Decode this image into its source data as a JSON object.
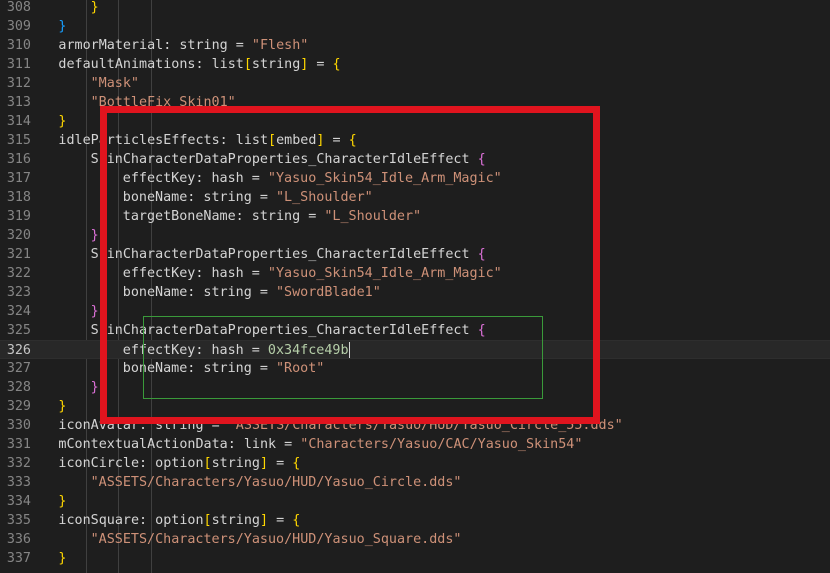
{
  "editor": {
    "current_line": "326",
    "lines": [
      {
        "num": "308",
        "indent": 3,
        "tokens": [
          {
            "t": "}",
            "c": "b1"
          }
        ]
      },
      {
        "num": "309",
        "indent": 2,
        "tokens": [
          {
            "t": "}",
            "c": "b3"
          }
        ]
      },
      {
        "num": "310",
        "indent": 2,
        "tokens": [
          {
            "t": "armorMaterial",
            "c": "p"
          },
          {
            "t": ": string = ",
            "c": "p"
          },
          {
            "t": "\"Flesh\"",
            "c": "s"
          }
        ]
      },
      {
        "num": "311",
        "indent": 2,
        "tokens": [
          {
            "t": "defaultAnimations",
            "c": "p"
          },
          {
            "t": ": list",
            "c": "p"
          },
          {
            "t": "[",
            "c": "b1"
          },
          {
            "t": "string",
            "c": "p"
          },
          {
            "t": "]",
            "c": "b1"
          },
          {
            "t": " = ",
            "c": "p"
          },
          {
            "t": "{",
            "c": "b1"
          }
        ]
      },
      {
        "num": "312",
        "indent": 3,
        "tokens": [
          {
            "t": "\"Mask\"",
            "c": "s"
          }
        ]
      },
      {
        "num": "313",
        "indent": 3,
        "tokens": [
          {
            "t": "\"BottleFix_Skin01\"",
            "c": "s"
          }
        ]
      },
      {
        "num": "314",
        "indent": 2,
        "tokens": [
          {
            "t": "}",
            "c": "b1"
          }
        ]
      },
      {
        "num": "315",
        "indent": 2,
        "tokens": [
          {
            "t": "idleParticlesEffects",
            "c": "p"
          },
          {
            "t": ": list",
            "c": "p"
          },
          {
            "t": "[",
            "c": "b1"
          },
          {
            "t": "embed",
            "c": "p"
          },
          {
            "t": "]",
            "c": "b1"
          },
          {
            "t": " = ",
            "c": "p"
          },
          {
            "t": "{",
            "c": "b1"
          }
        ]
      },
      {
        "num": "316",
        "indent": 3,
        "tokens": [
          {
            "t": "SkinCharacterDataProperties_CharacterIdleEffect ",
            "c": "p"
          },
          {
            "t": "{",
            "c": "b2"
          }
        ]
      },
      {
        "num": "317",
        "indent": 4,
        "tokens": [
          {
            "t": "effectKey",
            "c": "p"
          },
          {
            "t": ": hash = ",
            "c": "p"
          },
          {
            "t": "\"Yasuo_Skin54_Idle_Arm_Magic\"",
            "c": "s"
          }
        ]
      },
      {
        "num": "318",
        "indent": 4,
        "tokens": [
          {
            "t": "boneName",
            "c": "p"
          },
          {
            "t": ": string = ",
            "c": "p"
          },
          {
            "t": "\"L_Shoulder\"",
            "c": "s"
          }
        ]
      },
      {
        "num": "319",
        "indent": 4,
        "tokens": [
          {
            "t": "targetBoneName",
            "c": "p"
          },
          {
            "t": ": string = ",
            "c": "p"
          },
          {
            "t": "\"L_Shoulder\"",
            "c": "s"
          }
        ]
      },
      {
        "num": "320",
        "indent": 3,
        "tokens": [
          {
            "t": "}",
            "c": "b2"
          }
        ]
      },
      {
        "num": "321",
        "indent": 3,
        "tokens": [
          {
            "t": "SkinCharacterDataProperties_CharacterIdleEffect ",
            "c": "p"
          },
          {
            "t": "{",
            "c": "b2"
          }
        ]
      },
      {
        "num": "322",
        "indent": 4,
        "tokens": [
          {
            "t": "effectKey",
            "c": "p"
          },
          {
            "t": ": hash = ",
            "c": "p"
          },
          {
            "t": "\"Yasuo_Skin54_Idle_Arm_Magic\"",
            "c": "s"
          }
        ]
      },
      {
        "num": "323",
        "indent": 4,
        "tokens": [
          {
            "t": "boneName",
            "c": "p"
          },
          {
            "t": ": string = ",
            "c": "p"
          },
          {
            "t": "\"SwordBlade1\"",
            "c": "s"
          }
        ]
      },
      {
        "num": "324",
        "indent": 3,
        "tokens": [
          {
            "t": "}",
            "c": "b2"
          }
        ]
      },
      {
        "num": "325",
        "indent": 3,
        "tokens": [
          {
            "t": "SkinCharacterDataProperties_CharacterIdleEffect ",
            "c": "p"
          },
          {
            "t": "{",
            "c": "b2"
          }
        ]
      },
      {
        "num": "326",
        "indent": 4,
        "tokens": [
          {
            "t": "effectKey",
            "c": "p"
          },
          {
            "t": ": hash = ",
            "c": "p"
          },
          {
            "t": "0x34fce49b",
            "c": "n"
          }
        ],
        "cursor": true
      },
      {
        "num": "327",
        "indent": 4,
        "tokens": [
          {
            "t": "boneName",
            "c": "p"
          },
          {
            "t": ": string = ",
            "c": "p"
          },
          {
            "t": "\"Root\"",
            "c": "s"
          }
        ]
      },
      {
        "num": "328",
        "indent": 3,
        "tokens": [
          {
            "t": "}",
            "c": "b2"
          }
        ]
      },
      {
        "num": "329",
        "indent": 2,
        "tokens": [
          {
            "t": "}",
            "c": "b1"
          }
        ]
      },
      {
        "num": "330",
        "indent": 2,
        "tokens": [
          {
            "t": "iconAvatar",
            "c": "p"
          },
          {
            "t": ": string = ",
            "c": "p"
          },
          {
            "t": "\"ASSETS/Characters/Yasuo/HUD/Yasuo_Circle_55.dds\"",
            "c": "s"
          }
        ]
      },
      {
        "num": "331",
        "indent": 2,
        "tokens": [
          {
            "t": "mContextualActionData",
            "c": "p"
          },
          {
            "t": ": link = ",
            "c": "p"
          },
          {
            "t": "\"Characters/Yasuo/CAC/Yasuo_Skin54\"",
            "c": "s"
          }
        ]
      },
      {
        "num": "332",
        "indent": 2,
        "tokens": [
          {
            "t": "iconCircle",
            "c": "p"
          },
          {
            "t": ": option",
            "c": "p"
          },
          {
            "t": "[",
            "c": "b1"
          },
          {
            "t": "string",
            "c": "p"
          },
          {
            "t": "]",
            "c": "b1"
          },
          {
            "t": " = ",
            "c": "p"
          },
          {
            "t": "{",
            "c": "b1"
          }
        ]
      },
      {
        "num": "333",
        "indent": 3,
        "tokens": [
          {
            "t": "\"ASSETS/Characters/Yasuo/HUD/Yasuo_Circle.dds\"",
            "c": "s"
          }
        ]
      },
      {
        "num": "334",
        "indent": 2,
        "tokens": [
          {
            "t": "}",
            "c": "b1"
          }
        ]
      },
      {
        "num": "335",
        "indent": 2,
        "tokens": [
          {
            "t": "iconSquare",
            "c": "p"
          },
          {
            "t": ": option",
            "c": "p"
          },
          {
            "t": "[",
            "c": "b1"
          },
          {
            "t": "string",
            "c": "p"
          },
          {
            "t": "]",
            "c": "b1"
          },
          {
            "t": " = ",
            "c": "p"
          },
          {
            "t": "{",
            "c": "b1"
          }
        ]
      },
      {
        "num": "336",
        "indent": 3,
        "tokens": [
          {
            "t": "\"ASSETS/Characters/Yasuo/HUD/Yasuo_Square.dds\"",
            "c": "s"
          }
        ]
      },
      {
        "num": "337",
        "indent": 2,
        "tokens": [
          {
            "t": "}",
            "c": "b1"
          }
        ]
      }
    ]
  },
  "colors": {
    "background": "#1e1e1e",
    "string": "#ce9178",
    "number": "#b5cea8",
    "highlight_box": "#e0141e",
    "bracket_match_box": "#3a9a3a"
  }
}
